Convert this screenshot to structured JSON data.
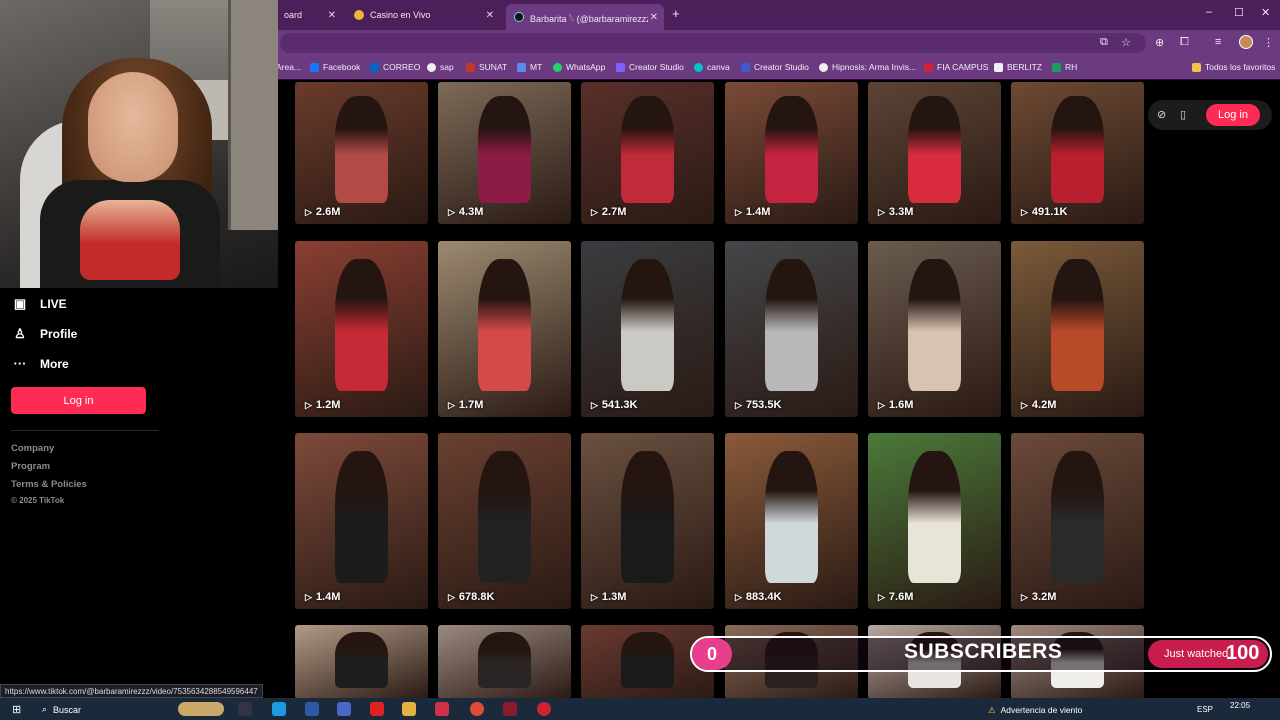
{
  "browser": {
    "tabs": [
      {
        "label": "oard",
        "active": false
      },
      {
        "label": "Casino en Vivo",
        "active": false
      },
      {
        "label": "Barbarita 𓆩 (@barbaramirezzz)",
        "active": true
      }
    ],
    "window_controls": [
      "–",
      "☐",
      "✕"
    ],
    "new_tab_icon": "+",
    "bookmarks": [
      "Area...",
      "Facebook",
      "CORREO",
      "sap",
      "SUNAT",
      "MT",
      "WhatsApp",
      "Creator Studio",
      "canva",
      "Creator Studio",
      "Hipnosis: Arma Invis...",
      "FIA CAMPUS",
      "BERLITZ",
      "RH"
    ],
    "bookmarks_folder": "Todos los favoritos",
    "status_url": "https://www.tiktok.com/@barbaramirezzz/video/7535634288549596447",
    "colors": {
      "frame": "#4a1f5a",
      "toolbar": "#6b3a80"
    }
  },
  "sidebar": {
    "items": [
      {
        "label": "LIVE",
        "icon": "live-icon"
      },
      {
        "label": "Profile",
        "icon": "profile-icon"
      },
      {
        "label": "More",
        "icon": "more-icon"
      }
    ],
    "login_label": "Log in",
    "footer_links": [
      "Company",
      "Program",
      "Terms & Policies"
    ],
    "copyright": "© 2025 TikTok"
  },
  "top_controls": {
    "login_label": "Log in",
    "icons": [
      "compass-icon",
      "mobile-icon"
    ],
    "accent": "#fe2c55"
  },
  "videos": [
    {
      "views": "2.6M"
    },
    {
      "views": "4.3M"
    },
    {
      "views": "2.7M"
    },
    {
      "views": "1.4M"
    },
    {
      "views": "3.3M"
    },
    {
      "views": "491.1K"
    },
    {
      "views": "1.2M"
    },
    {
      "views": "1.7M"
    },
    {
      "views": "541.3K"
    },
    {
      "views": "753.5K"
    },
    {
      "views": "1.6M"
    },
    {
      "views": "4.2M"
    },
    {
      "views": "1.4M"
    },
    {
      "views": "678.8K"
    },
    {
      "views": "1.3M"
    },
    {
      "views": "883.4K"
    },
    {
      "views": "7.6M"
    },
    {
      "views": "3.2M"
    },
    {
      "views": ""
    },
    {
      "views": ""
    },
    {
      "views": ""
    },
    {
      "views": ""
    },
    {
      "views": ""
    },
    {
      "views": ""
    }
  ],
  "stream_overlay": {
    "subscriber_count": "0",
    "label": "SUBSCRIBERS",
    "just_watched_label": "Just watched",
    "just_watched_value": "100"
  },
  "taskbar": {
    "search_label": "Buscar",
    "weather": "Advertencia de viento",
    "language": "ESP",
    "time": "22:05"
  }
}
